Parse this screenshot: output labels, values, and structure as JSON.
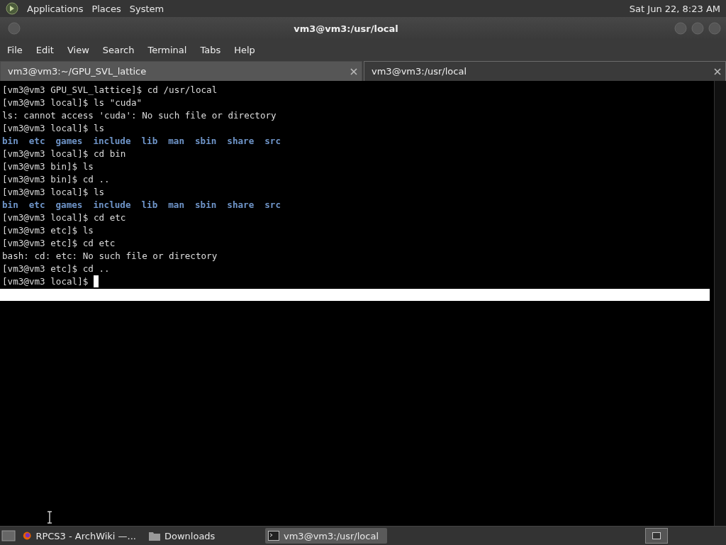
{
  "top_panel": {
    "menus": [
      "Applications",
      "Places",
      "System"
    ],
    "clock": "Sat Jun 22, 8:23 AM"
  },
  "window": {
    "title": "vm3@vm3:/usr/local"
  },
  "menu_bar": [
    "File",
    "Edit",
    "View",
    "Search",
    "Terminal",
    "Tabs",
    "Help"
  ],
  "tabs": [
    {
      "label": "vm3@vm3:~/GPU_SVL_lattice",
      "selected": false
    },
    {
      "label": "vm3@vm3:/usr/local",
      "selected": true
    }
  ],
  "terminal": {
    "lines": [
      {
        "kind": "text",
        "text": "[vm3@vm3 GPU_SVL_lattice]$ cd /usr/local"
      },
      {
        "kind": "text",
        "text": "[vm3@vm3 local]$ ls \"cuda\""
      },
      {
        "kind": "text",
        "text": "ls: cannot access 'cuda': No such file or directory"
      },
      {
        "kind": "text",
        "text": "[vm3@vm3 local]$ ls"
      },
      {
        "kind": "listing",
        "items": [
          "bin",
          "etc",
          "games",
          "include",
          "lib",
          "man",
          "sbin",
          "share",
          "src"
        ]
      },
      {
        "kind": "text",
        "text": "[vm3@vm3 local]$ cd bin"
      },
      {
        "kind": "text",
        "text": "[vm3@vm3 bin]$ ls"
      },
      {
        "kind": "text",
        "text": "[vm3@vm3 bin]$ cd .."
      },
      {
        "kind": "text",
        "text": "[vm3@vm3 local]$ ls"
      },
      {
        "kind": "listing",
        "items": [
          "bin",
          "etc",
          "games",
          "include",
          "lib",
          "man",
          "sbin",
          "share",
          "src"
        ]
      },
      {
        "kind": "text",
        "text": "[vm3@vm3 local]$ cd etc"
      },
      {
        "kind": "text",
        "text": "[vm3@vm3 etc]$ ls"
      },
      {
        "kind": "text",
        "text": "[vm3@vm3 etc]$ cd etc"
      },
      {
        "kind": "text",
        "text": "bash: cd: etc: No such file or directory"
      },
      {
        "kind": "text",
        "text": "[vm3@vm3 etc]$ cd .."
      },
      {
        "kind": "prompt",
        "text": "[vm3@vm3 local]$ "
      },
      {
        "kind": "highlight"
      }
    ]
  },
  "taskbar": [
    {
      "kind": "browser",
      "label": "RPCS3 - ArchWiki —...",
      "selected": false
    },
    {
      "kind": "folder",
      "label": "Downloads",
      "selected": false
    },
    {
      "kind": "terminal",
      "label": "vm3@vm3:/usr/local",
      "selected": true
    }
  ]
}
